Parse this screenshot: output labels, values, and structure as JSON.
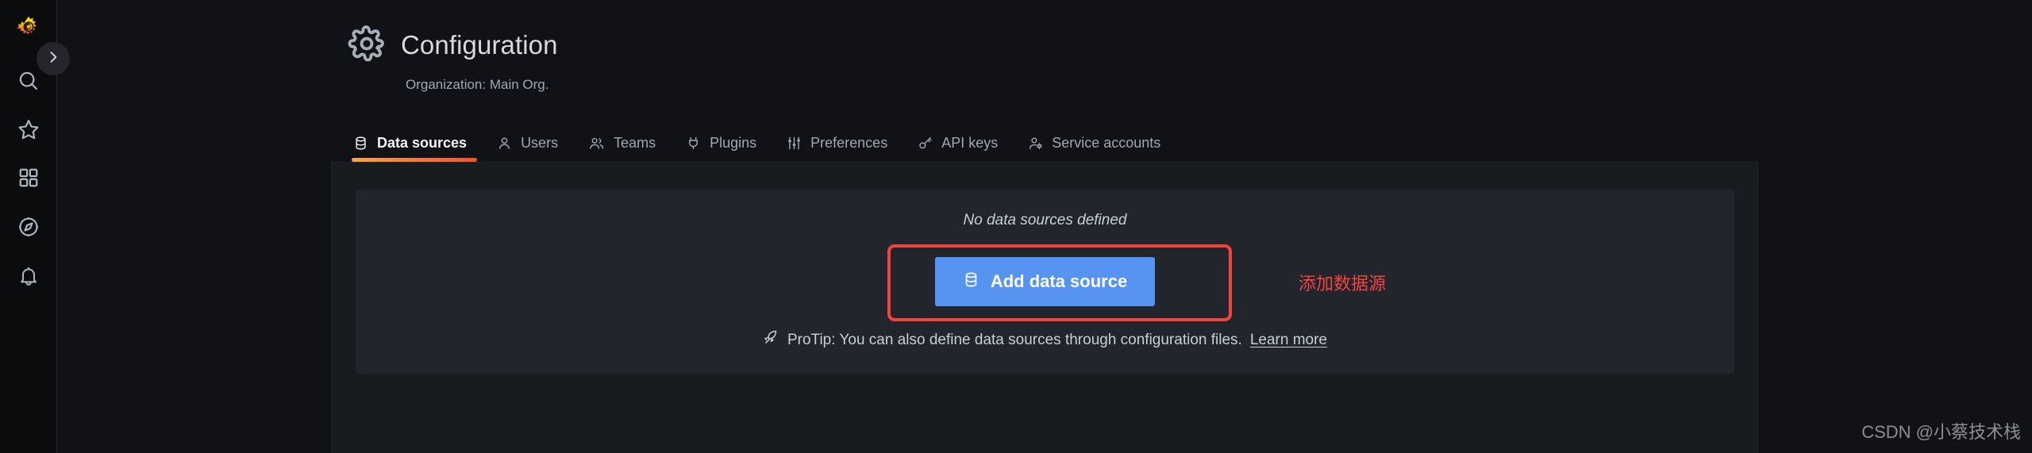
{
  "app": {
    "brand_icon": "grafana-logo-icon",
    "accent_orange": "#f2542c",
    "accent_blue": "#5794f2",
    "annotation_red": "#f3453f",
    "panel_bg": "#181b1f",
    "card_bg": "#22252b"
  },
  "sidebar": {
    "toggle_icon": "chevron-right-icon",
    "items": [
      {
        "icon": "grafana-logo-icon",
        "name": "home-logo"
      },
      {
        "icon": "search-icon",
        "name": "search"
      },
      {
        "icon": "star-icon",
        "name": "starred"
      },
      {
        "icon": "dashboards-grid-icon",
        "name": "dashboards"
      },
      {
        "icon": "compass-icon",
        "name": "explore"
      },
      {
        "icon": "bell-icon",
        "name": "alerting"
      }
    ]
  },
  "header": {
    "icon": "gear-icon",
    "title": "Configuration",
    "subtitle": "Organization: Main Org."
  },
  "tabs": [
    {
      "label": "Data sources",
      "icon": "database-icon",
      "active": true
    },
    {
      "label": "Users",
      "icon": "user-icon",
      "active": false
    },
    {
      "label": "Teams",
      "icon": "users-icon",
      "active": false
    },
    {
      "label": "Plugins",
      "icon": "plug-icon",
      "active": false
    },
    {
      "label": "Preferences",
      "icon": "sliders-icon",
      "active": false
    },
    {
      "label": "API keys",
      "icon": "key-icon",
      "active": false
    },
    {
      "label": "Service accounts",
      "icon": "user-gear-icon",
      "active": false
    }
  ],
  "main": {
    "empty_title": "No data sources defined",
    "add_button_label": "Add data source",
    "add_button_icon": "database-icon",
    "protip_icon": "rocket-icon",
    "protip_text": "ProTip: You can also define data sources through configuration files.",
    "protip_link": "Learn more"
  },
  "annotation": {
    "label": "添加数据源",
    "box_color": "#f3453f"
  },
  "watermark": {
    "text": "CSDN @小蔡技术栈"
  }
}
